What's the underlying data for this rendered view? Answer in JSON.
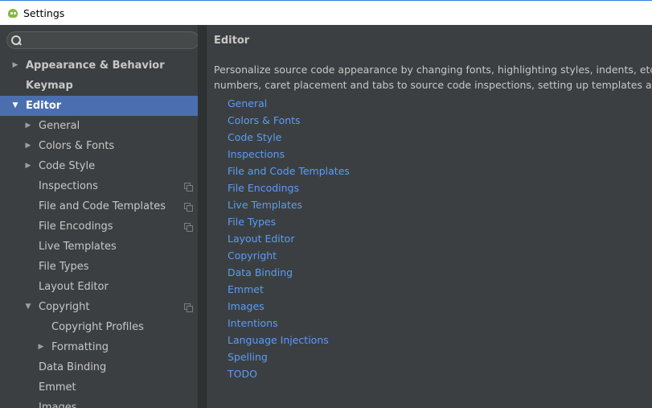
{
  "window": {
    "title": "Settings"
  },
  "search": {
    "placeholder": ""
  },
  "tree": {
    "appearance": "Appearance & Behavior",
    "keymap": "Keymap",
    "editor": "Editor",
    "general": "General",
    "colors_fonts": "Colors & Fonts",
    "code_style": "Code Style",
    "inspections": "Inspections",
    "file_code_templates": "File and Code Templates",
    "file_encodings": "File Encodings",
    "live_templates": "Live Templates",
    "file_types": "File Types",
    "layout_editor": "Layout Editor",
    "copyright": "Copyright",
    "copyright_profiles": "Copyright Profiles",
    "formatting": "Formatting",
    "data_binding": "Data Binding",
    "emmet": "Emmet",
    "images": "Images"
  },
  "main": {
    "title": "Editor",
    "description_line1": "Personalize source code appearance by changing fonts, highlighting styles, indents, etc. Custo",
    "description_line2": "numbers, caret placement and tabs to source code inspections, setting up templates and file",
    "links": [
      "General",
      "Colors & Fonts",
      "Code Style",
      "Inspections",
      "File and Code Templates",
      "File Encodings",
      "Live Templates",
      "File Types",
      "Layout Editor",
      "Copyright",
      "Data Binding",
      "Emmet",
      "Images",
      "Intentions",
      "Language Injections",
      "Spelling",
      "TODO"
    ]
  },
  "colors": {
    "selection": "#4b6eaf",
    "link": "#589df6",
    "background": "#3c3f41",
    "text": "#c7c7c7"
  },
  "icons": {
    "app": "android-studio-icon",
    "search": "search-icon",
    "copy": "project-scope-icon"
  }
}
